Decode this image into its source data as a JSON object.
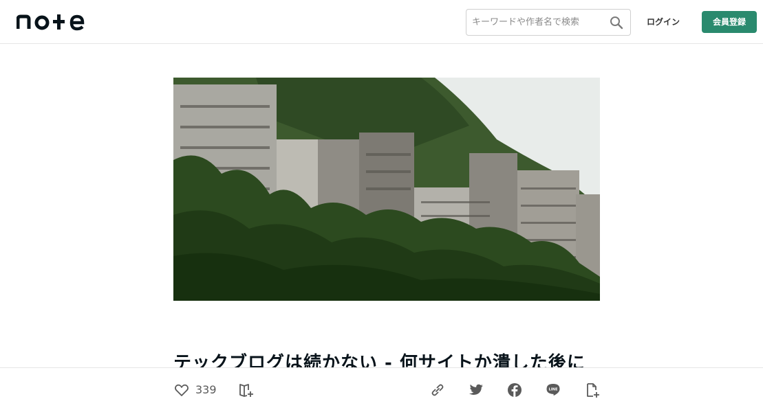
{
  "header": {
    "logo_text": "note",
    "search": {
      "placeholder": "キーワードや作者名で検索"
    },
    "login_label": "ログイン",
    "register_label": "会員登録"
  },
  "article": {
    "title": "テックブログは続かない - 何サイトか潰した後に"
  },
  "footer": {
    "like_count": "339",
    "icons": [
      "heart-icon",
      "magazine-add-icon",
      "link-icon",
      "twitter-icon",
      "facebook-icon",
      "line-icon",
      "embed-icon"
    ]
  },
  "colors": {
    "brand_green": "#2a8a6e",
    "text": "#08131a",
    "icon_gray": "#5a5a5a"
  }
}
